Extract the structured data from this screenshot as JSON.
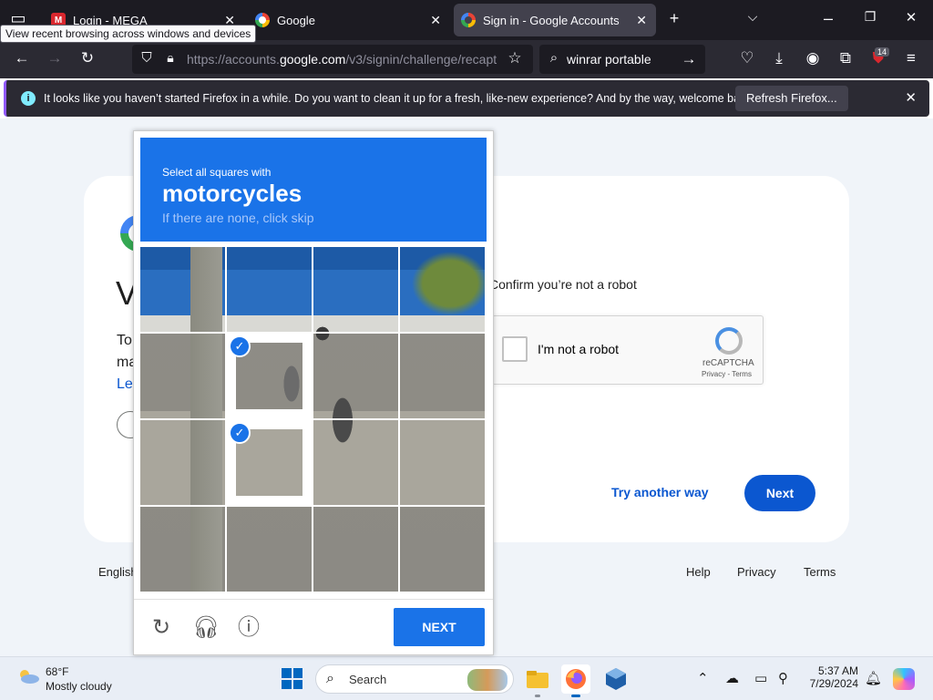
{
  "browser": {
    "tooltip": "View recent browsing across windows and devices",
    "tabs": [
      {
        "title": "Login - MEGA",
        "favicon": "mega-icon",
        "active": false
      },
      {
        "title": "Google",
        "favicon": "google-icon",
        "active": false
      },
      {
        "title": "Sign in - Google Accounts",
        "favicon": "google-icon",
        "active": true
      }
    ],
    "url_prefix": "https://accounts.",
    "url_domain": "google.com",
    "url_rest": "/v3/signin/challenge/recapt",
    "search_query": "winrar portable",
    "extensions_badge": "14",
    "notification": {
      "message": "It looks like you haven’t started Firefox in a while. Do you want to clean it up for a fresh, like-new experience? And by the way, welcome back!",
      "button": "Refresh Firefox..."
    }
  },
  "page": {
    "heading_peek": "V",
    "line1_peek": "To",
    "line2_peek": "ma",
    "line3_peek": "Le",
    "confirm_text": "Confirm you’re not a robot",
    "recaptcha": {
      "label": "I'm not a robot",
      "brand": "reCAPTCHA",
      "links": "Privacy - Terms"
    },
    "try_another": "Try another way",
    "next": "Next",
    "footer": {
      "language": "English",
      "help": "Help",
      "privacy": "Privacy",
      "terms": "Terms"
    }
  },
  "challenge": {
    "instruction": "Select all squares with",
    "target": "motorcycles",
    "hint": "If there are none, click skip",
    "grid_rows": 4,
    "grid_cols": 4,
    "selected_tiles": [
      [
        1,
        1
      ],
      [
        2,
        1
      ]
    ],
    "verify_label": "NEXT",
    "icons": [
      "reload-icon",
      "audio-icon",
      "info-icon"
    ]
  },
  "taskbar": {
    "temperature": "68°F",
    "condition": "Mostly cloudy",
    "search_label": "Search",
    "time": "5:37 AM",
    "date": "7/29/2024"
  },
  "colors": {
    "challenge_blue": "#1a73e8",
    "google_blue": "#0b57d0",
    "firefox_dark": "#1c1b22"
  }
}
